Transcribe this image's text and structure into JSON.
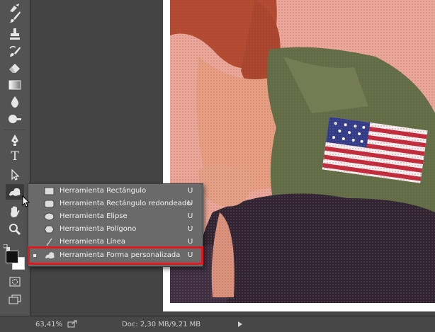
{
  "colors": {
    "accent_highlight": "#e0181f",
    "panel_bg": "#535353",
    "menu_bg": "#6a6a6a"
  },
  "toolbar": {
    "tools": [
      {
        "name": "eraser-brush-icon"
      },
      {
        "name": "brush-icon"
      },
      {
        "name": "stamp-icon"
      },
      {
        "name": "history-brush-icon"
      },
      {
        "name": "eraser-icon"
      },
      {
        "name": "gradient-icon"
      },
      {
        "name": "drop-icon"
      },
      {
        "name": "dodge-icon"
      },
      {
        "name": "pen-icon"
      },
      {
        "name": "type-tool-icon",
        "glyph": "T"
      },
      {
        "name": "path-selection-icon"
      },
      {
        "name": "custom-shape-icon"
      },
      {
        "name": "hand-icon"
      },
      {
        "name": "zoom-icon"
      }
    ]
  },
  "flyout": {
    "items": [
      {
        "label": "Herramienta Rectángulo",
        "shortcut": "U",
        "icon": "rectangle-icon"
      },
      {
        "label": "Herramienta Rectángulo redondeado",
        "shortcut": "U",
        "icon": "rounded-rectangle-icon"
      },
      {
        "label": "Herramienta Elipse",
        "shortcut": "U",
        "icon": "ellipse-icon"
      },
      {
        "label": "Herramienta Polígono",
        "shortcut": "U",
        "icon": "polygon-icon"
      },
      {
        "label": "Herramienta Línea",
        "shortcut": "U",
        "icon": "line-icon"
      },
      {
        "label": "Herramienta Forma personalizada",
        "shortcut": "U",
        "icon": "custom-shape-icon",
        "selected": true
      }
    ]
  },
  "status": {
    "zoom": "63,41%",
    "doc": "Doc: 2,30 MB/9,21 MB"
  }
}
